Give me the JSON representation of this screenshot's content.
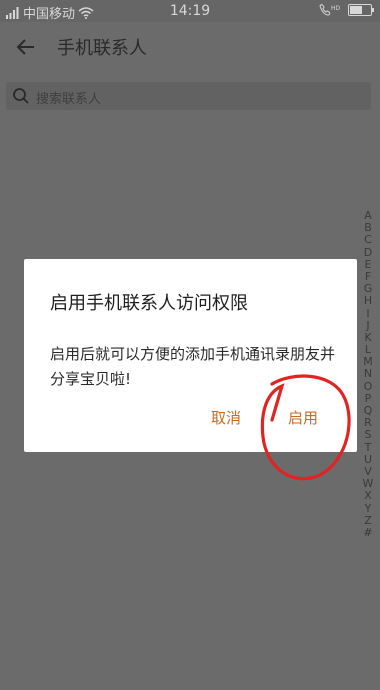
{
  "status_bar": {
    "carrier": "中国移动",
    "time": "14:19",
    "hd_badge": "HD"
  },
  "header": {
    "title": "手机联系人",
    "back_icon": "arrow-left-icon"
  },
  "search": {
    "placeholder": "搜索联系人",
    "icon": "search-icon"
  },
  "alphabet_index": [
    "A",
    "B",
    "C",
    "D",
    "E",
    "F",
    "G",
    "H",
    "I",
    "J",
    "K",
    "L",
    "M",
    "N",
    "O",
    "P",
    "Q",
    "R",
    "S",
    "T",
    "U",
    "V",
    "W",
    "X",
    "Y",
    "Z",
    "#"
  ],
  "dialog": {
    "title": "启用手机联系人访问权限",
    "message": "启用后就可以方便的添加手机通讯录朋友并分享宝贝啦!",
    "cancel_label": "取消",
    "confirm_label": "启用",
    "button_color": "#c96a1f"
  },
  "annotation": {
    "color": "#e02424"
  }
}
